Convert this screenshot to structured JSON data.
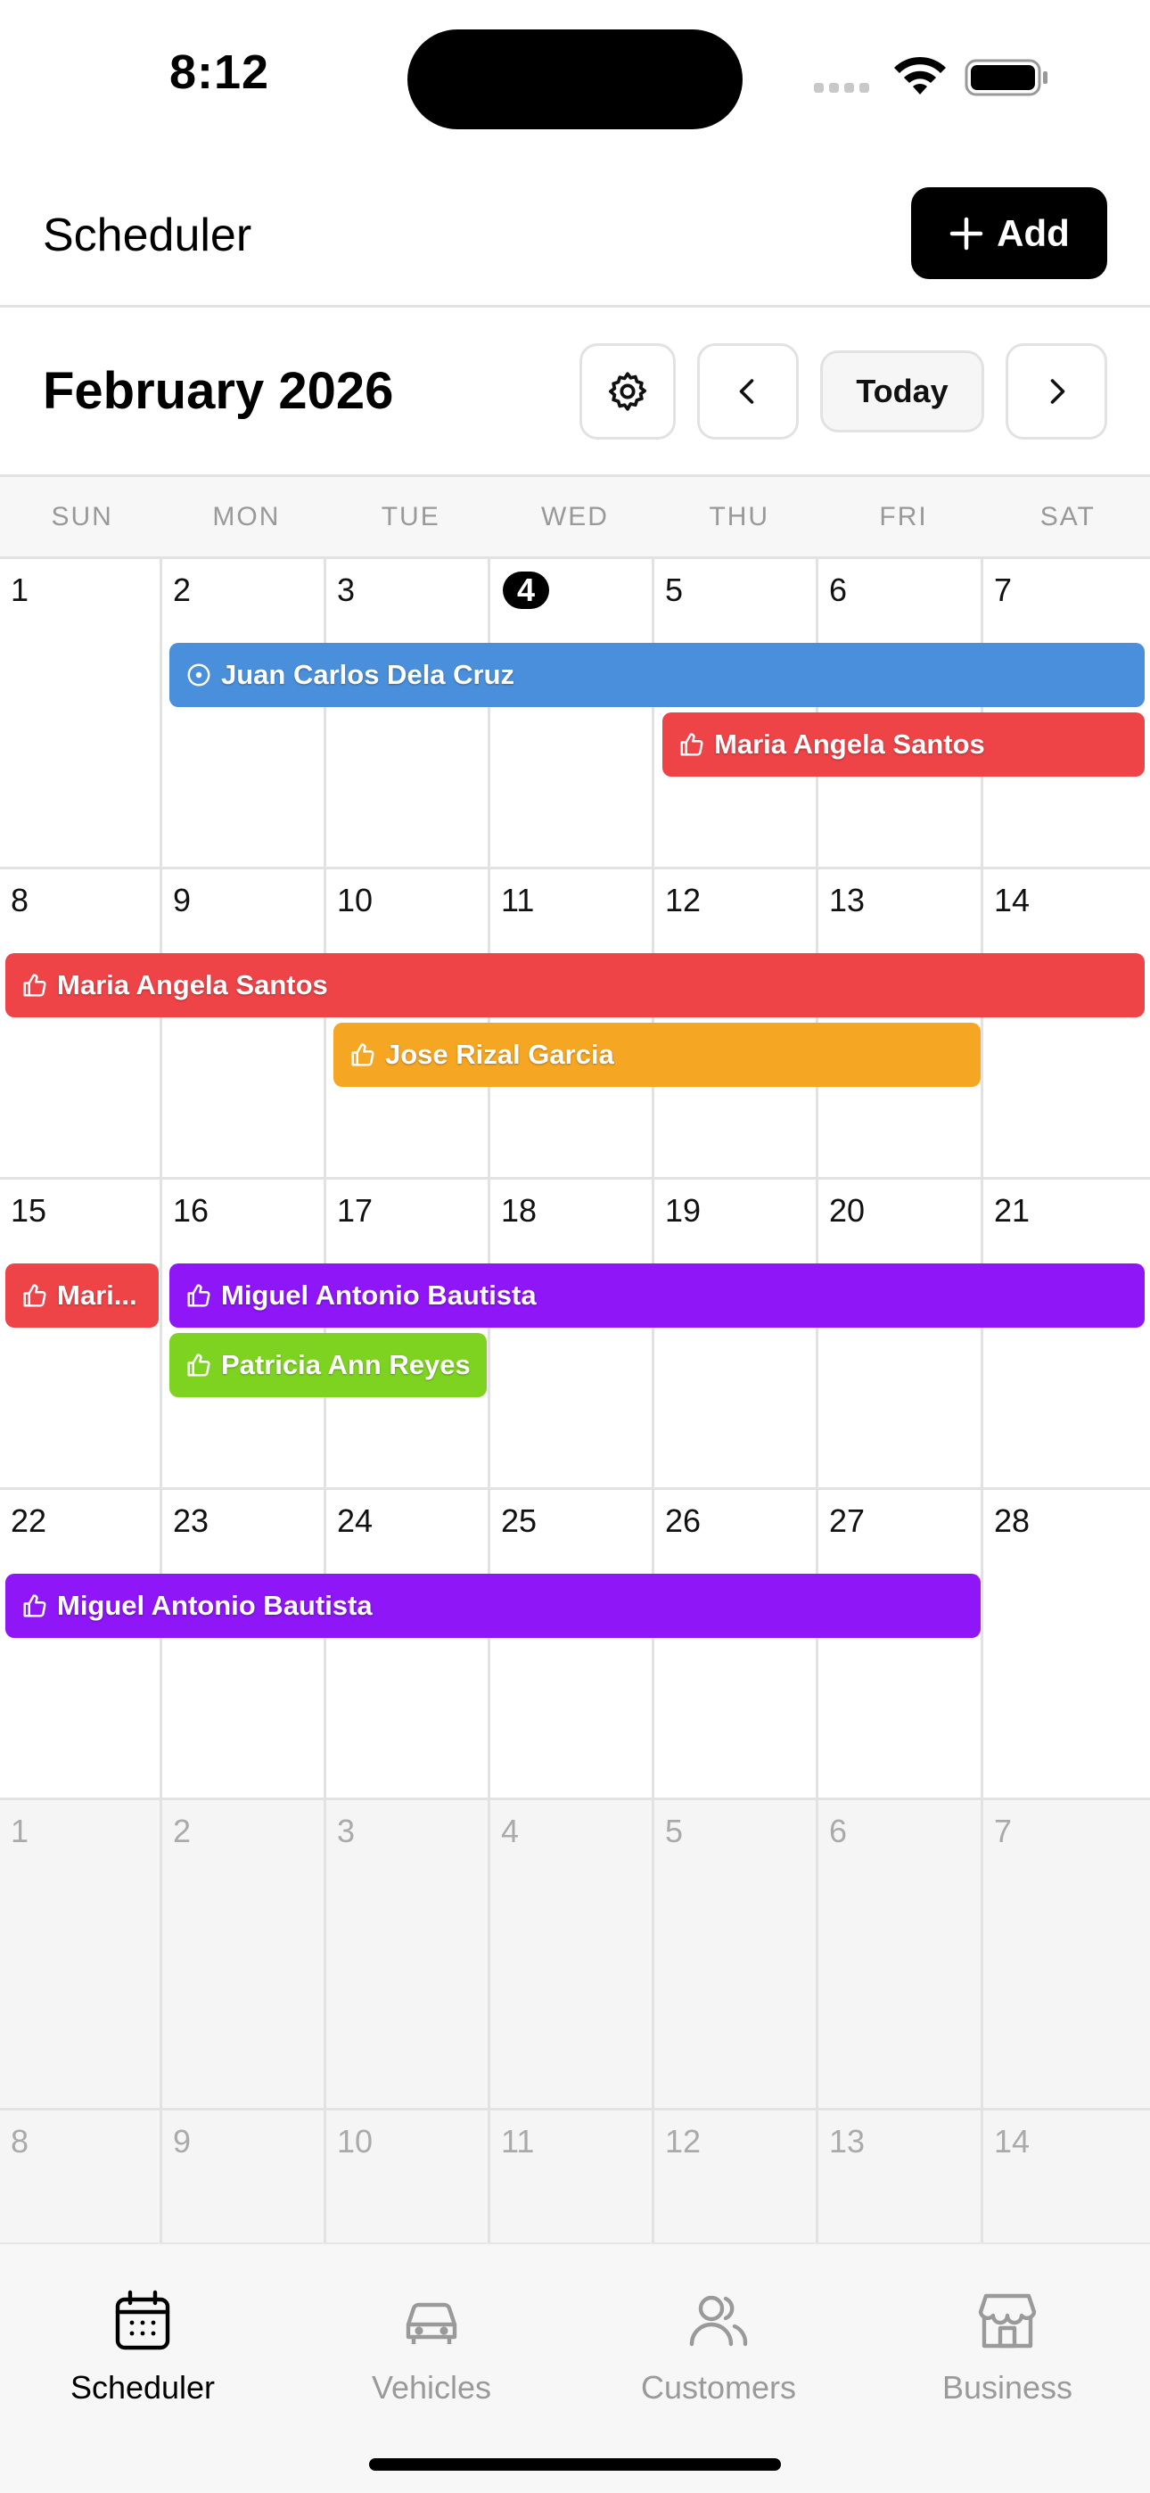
{
  "status": {
    "time": "8:12"
  },
  "header": {
    "title": "Scheduler",
    "add_label": "Add"
  },
  "calendar": {
    "month_title": "February 2026",
    "today_label": "Today",
    "weekdays": [
      "SUN",
      "MON",
      "TUE",
      "WED",
      "THU",
      "FRI",
      "SAT"
    ],
    "weeks": [
      [
        "1",
        "2",
        "3",
        "4",
        "5",
        "6",
        "7"
      ],
      [
        "8",
        "9",
        "10",
        "11",
        "12",
        "13",
        "14"
      ],
      [
        "15",
        "16",
        "17",
        "18",
        "19",
        "20",
        "21"
      ],
      [
        "22",
        "23",
        "24",
        "25",
        "26",
        "27",
        "28"
      ],
      [
        "1",
        "2",
        "3",
        "4",
        "5",
        "6",
        "7"
      ],
      [
        "8",
        "9",
        "10",
        "11",
        "12",
        "13",
        "14"
      ]
    ],
    "today_day": "4",
    "events": {
      "e1": {
        "name": "Juan Carlos Dela Cruz",
        "color": "#4A8FDB",
        "icon": "clock-icon"
      },
      "e2": {
        "name": "Maria Angela Santos",
        "color": "#EE4347",
        "icon": "thumbs-up-icon"
      },
      "e3": {
        "name": "Maria Angela Santos",
        "color": "#EE4347",
        "icon": "thumbs-up-icon"
      },
      "e4": {
        "name": "Jose Rizal Garcia",
        "color": "#F5A623",
        "icon": "thumbs-up-icon"
      },
      "e5": {
        "name": "Mari...",
        "color": "#EE4347",
        "icon": "thumbs-up-icon"
      },
      "e6": {
        "name": "Miguel Antonio Bautista",
        "color": "#8E16F7",
        "icon": "thumbs-up-icon"
      },
      "e7": {
        "name": "Patricia Ann Reyes",
        "color": "#7ED321",
        "icon": "thumbs-up-icon"
      },
      "e8": {
        "name": "Miguel Antonio Bautista",
        "color": "#8E16F7",
        "icon": "thumbs-up-icon"
      }
    }
  },
  "tabs": [
    {
      "label": "Scheduler",
      "icon": "calendar-icon",
      "active": true
    },
    {
      "label": "Vehicles",
      "icon": "car-icon",
      "active": false
    },
    {
      "label": "Customers",
      "icon": "users-icon",
      "active": false
    },
    {
      "label": "Business",
      "icon": "store-icon",
      "active": false
    }
  ]
}
